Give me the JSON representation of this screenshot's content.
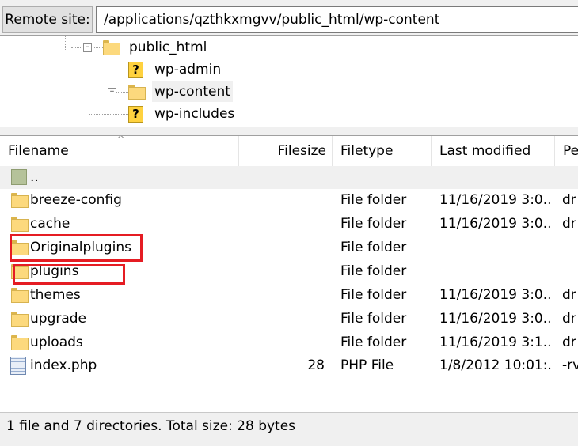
{
  "remote_site": {
    "label": "Remote site:",
    "path": "/applications/qzthkxmgvv/public_html/wp-content"
  },
  "tree": {
    "nodes": [
      {
        "label": "public_html",
        "icon": "folder-icon",
        "expander": "−"
      },
      {
        "label": "wp-admin",
        "icon": "question-icon"
      },
      {
        "label": "wp-content",
        "icon": "folder-icon",
        "expander": "+",
        "selected": true
      },
      {
        "label": "wp-includes",
        "icon": "question-icon"
      }
    ]
  },
  "file_list": {
    "columns": [
      "Filename",
      "Filesize",
      "Filetype",
      "Last modified",
      "Pe"
    ],
    "sort_indicator": "^",
    "rows": [
      {
        "name": "..",
        "size": "",
        "type": "",
        "modified": "",
        "perm": "",
        "icon": "parent-directory-icon"
      },
      {
        "name": "breeze-config",
        "size": "",
        "type": "File folder",
        "modified": "11/16/2019 3:0...",
        "perm": "dr",
        "icon": "folder-icon"
      },
      {
        "name": "cache",
        "size": "",
        "type": "File folder",
        "modified": "11/16/2019 3:0...",
        "perm": "dr",
        "icon": "folder-icon"
      },
      {
        "name": "Originalplugins",
        "size": "",
        "type": "File folder",
        "modified": "",
        "perm": "",
        "icon": "folder-icon"
      },
      {
        "name": "plugins",
        "size": "",
        "type": "File folder",
        "modified": "",
        "perm": "",
        "icon": "folder-icon"
      },
      {
        "name": "themes",
        "size": "",
        "type": "File folder",
        "modified": "11/16/2019 3:0...",
        "perm": "dr",
        "icon": "folder-icon"
      },
      {
        "name": "upgrade",
        "size": "",
        "type": "File folder",
        "modified": "11/16/2019 3:0...",
        "perm": "dr",
        "icon": "folder-icon"
      },
      {
        "name": "uploads",
        "size": "",
        "type": "File folder",
        "modified": "11/16/2019 3:1...",
        "perm": "dr",
        "icon": "folder-icon"
      },
      {
        "name": "index.php",
        "size": "28",
        "type": "PHP File",
        "modified": "1/8/2012 10:01:...",
        "perm": "-rv",
        "icon": "php-file-icon"
      }
    ]
  },
  "status": {
    "text": "1 file and 7 directories. Total size: 28 bytes"
  },
  "colors": {
    "highlight": "#e51c23",
    "folder": "#fcd97d"
  }
}
